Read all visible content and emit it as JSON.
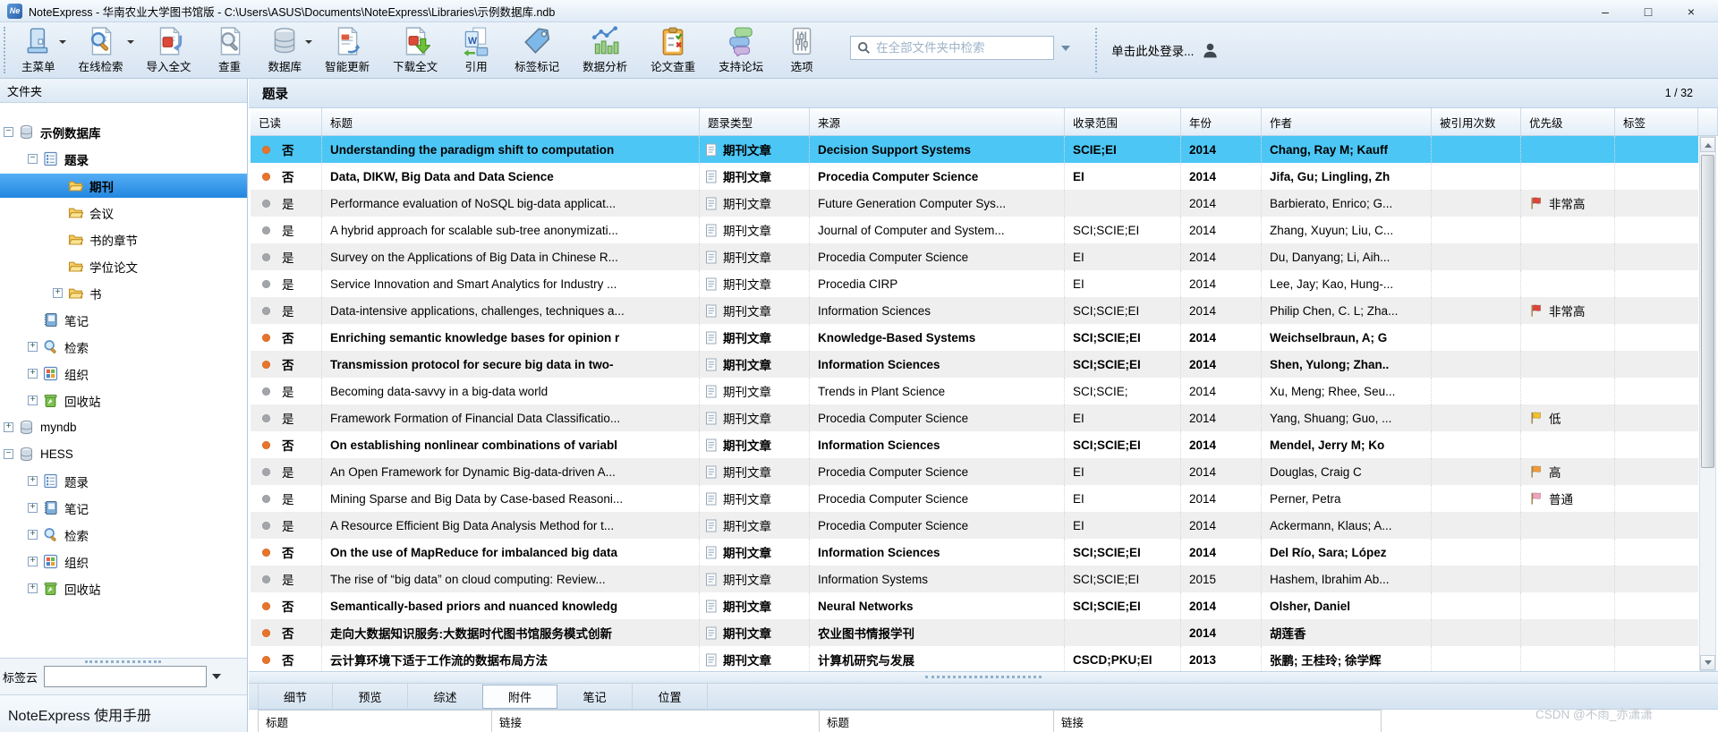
{
  "window": {
    "title": "NoteExpress - 华南农业大学图书馆版 - C:\\Users\\ASUS\\Documents\\NoteExpress\\Libraries\\示例数据库.ndb",
    "controls": {
      "minimize": "–",
      "maximize": "□",
      "close": "×"
    }
  },
  "toolbar": {
    "items": [
      {
        "label": "主菜单",
        "icon": "main-menu-icon",
        "dropdown": true
      },
      {
        "label": "在线检索",
        "icon": "online-search-icon",
        "dropdown": true
      },
      {
        "label": "导入全文",
        "icon": "import-fulltext-icon",
        "dropdown": false
      },
      {
        "label": "查重",
        "icon": "dedupe-icon",
        "dropdown": false
      },
      {
        "label": "数据库",
        "icon": "database-icon",
        "dropdown": true
      },
      {
        "label": "智能更新",
        "icon": "smart-update-icon",
        "dropdown": false
      },
      {
        "label": "下载全文",
        "icon": "download-fulltext-icon",
        "dropdown": false
      },
      {
        "label": "引用",
        "icon": "cite-icon",
        "dropdown": false
      },
      {
        "label": "标签标记",
        "icon": "tag-mark-icon",
        "dropdown": false
      },
      {
        "label": "数据分析",
        "icon": "data-analysis-icon",
        "dropdown": false
      },
      {
        "label": "论文查重",
        "icon": "paper-check-icon",
        "dropdown": false
      },
      {
        "label": "支持论坛",
        "icon": "forum-icon",
        "dropdown": false
      },
      {
        "label": "选项",
        "icon": "options-icon",
        "dropdown": false
      }
    ],
    "search": {
      "placeholder": "在全部文件夹中检索",
      "value": ""
    },
    "login_label": "单击此处登录..."
  },
  "sidebar": {
    "header": "文件夹",
    "tree": [
      {
        "label": "示例数据库",
        "icon": "database",
        "level": 0,
        "expander": "minus",
        "selected": false,
        "bold": true
      },
      {
        "label": "题录",
        "icon": "list",
        "level": 1,
        "expander": "minus",
        "selected": false,
        "bold": true
      },
      {
        "label": "期刊",
        "icon": "folder",
        "level": 2,
        "expander": "none",
        "selected": true,
        "bold": true
      },
      {
        "label": "会议",
        "icon": "folder",
        "level": 2,
        "expander": "none",
        "selected": false,
        "bold": false
      },
      {
        "label": "书的章节",
        "icon": "folder",
        "level": 2,
        "expander": "none",
        "selected": false,
        "bold": false
      },
      {
        "label": "学位论文",
        "icon": "folder",
        "level": 2,
        "expander": "none",
        "selected": false,
        "bold": false
      },
      {
        "label": "书",
        "icon": "folder",
        "level": 2,
        "expander": "plus",
        "selected": false,
        "bold": false
      },
      {
        "label": "笔记",
        "icon": "notebook",
        "level": 1,
        "expander": "none",
        "selected": false,
        "bold": false
      },
      {
        "label": "检索",
        "icon": "search",
        "level": 1,
        "expander": "plus",
        "selected": false,
        "bold": false
      },
      {
        "label": "组织",
        "icon": "grid",
        "level": 1,
        "expander": "plus",
        "selected": false,
        "bold": false
      },
      {
        "label": "回收站",
        "icon": "trash",
        "level": 1,
        "expander": "plus",
        "selected": false,
        "bold": false
      },
      {
        "label": "myndb",
        "icon": "database",
        "level": 0,
        "expander": "plus",
        "selected": false,
        "bold": false
      },
      {
        "label": "HESS",
        "icon": "database",
        "level": 0,
        "expander": "minus",
        "selected": false,
        "bold": false
      },
      {
        "label": "题录",
        "icon": "list",
        "level": 1,
        "expander": "plus",
        "selected": false,
        "bold": false
      },
      {
        "label": "笔记",
        "icon": "notebook",
        "level": 1,
        "expander": "plus",
        "selected": false,
        "bold": false
      },
      {
        "label": "检索",
        "icon": "search",
        "level": 1,
        "expander": "plus",
        "selected": false,
        "bold": false
      },
      {
        "label": "组织",
        "icon": "grid",
        "level": 1,
        "expander": "plus",
        "selected": false,
        "bold": false
      },
      {
        "label": "回收站",
        "icon": "trash",
        "level": 1,
        "expander": "plus",
        "selected": false,
        "bold": false
      }
    ],
    "tag_cloud_label": "标签云",
    "tag_cloud_value": "",
    "manual_label": "NoteExpress  使用手册"
  },
  "main": {
    "title": "题录",
    "page_indicator": "1 / 32",
    "columns": [
      "已读",
      "标题",
      "题录类型",
      "来源",
      "收录范围",
      "年份",
      "作者",
      "被引用次数",
      "优先级",
      "标签"
    ],
    "rows": [
      {
        "read_state": "否",
        "unread": true,
        "selected": true,
        "title": "Understanding the paradigm shift to computation",
        "type": "期刊文章",
        "source": "Decision Support Systems",
        "scope": "SCIE;EI",
        "year": "2014",
        "authors": "Chang, Ray M; Kauff",
        "cited": "",
        "priority": "",
        "priority_color": "",
        "tag": ""
      },
      {
        "read_state": "否",
        "unread": true,
        "selected": false,
        "title": "Data, DIKW, Big Data and Data Science",
        "type": "期刊文章",
        "source": "Procedia Computer Science",
        "scope": "EI",
        "year": "2014",
        "authors": "Jifa, Gu; Lingling, Zh",
        "cited": "",
        "priority": "",
        "priority_color": "",
        "tag": ""
      },
      {
        "read_state": "是",
        "unread": false,
        "selected": false,
        "title": "Performance evaluation of NoSQL big-data applicat...",
        "type": "期刊文章",
        "source": "Future Generation Computer Sys...",
        "scope": "",
        "year": "2014",
        "authors": "Barbierato, Enrico; G...",
        "cited": "",
        "priority": "非常高",
        "priority_color": "#e04438",
        "tag": ""
      },
      {
        "read_state": "是",
        "unread": false,
        "selected": false,
        "title": "A hybrid approach for scalable sub-tree anonymizati...",
        "type": "期刊文章",
        "source": "Journal of Computer and System...",
        "scope": "SCI;SCIE;EI",
        "year": "2014",
        "authors": "Zhang, Xuyun; Liu, C...",
        "cited": "",
        "priority": "",
        "priority_color": "",
        "tag": ""
      },
      {
        "read_state": "是",
        "unread": false,
        "selected": false,
        "title": "Survey on the Applications of Big Data in Chinese R...",
        "type": "期刊文章",
        "source": "Procedia Computer Science",
        "scope": "EI",
        "year": "2014",
        "authors": "Du, Danyang; Li, Aih...",
        "cited": "",
        "priority": "",
        "priority_color": "",
        "tag": ""
      },
      {
        "read_state": "是",
        "unread": false,
        "selected": false,
        "title": "Service Innovation and Smart Analytics for Industry ...",
        "type": "期刊文章",
        "source": "Procedia CIRP",
        "scope": "EI",
        "year": "2014",
        "authors": "Lee, Jay; Kao, Hung-...",
        "cited": "",
        "priority": "",
        "priority_color": "",
        "tag": ""
      },
      {
        "read_state": "是",
        "unread": false,
        "selected": false,
        "title": "Data-intensive applications, challenges, techniques a...",
        "type": "期刊文章",
        "source": "Information Sciences",
        "scope": "SCI;SCIE;EI",
        "year": "2014",
        "authors": "Philip Chen, C. L; Zha...",
        "cited": "",
        "priority": "非常高",
        "priority_color": "#e04438",
        "tag": ""
      },
      {
        "read_state": "否",
        "unread": true,
        "selected": false,
        "title": "Enriching semantic knowledge bases for opinion r",
        "type": "期刊文章",
        "source": "Knowledge-Based Systems",
        "scope": "SCI;SCIE;EI",
        "year": "2014",
        "authors": "Weichselbraun, A; G",
        "cited": "",
        "priority": "",
        "priority_color": "",
        "tag": ""
      },
      {
        "read_state": "否",
        "unread": true,
        "selected": false,
        "title": "Transmission protocol for secure big data in two-",
        "type": "期刊文章",
        "source": "Information Sciences",
        "scope": "SCI;SCIE;EI",
        "year": "2014",
        "authors": "Shen, Yulong; Zhan..",
        "cited": "",
        "priority": "",
        "priority_color": "",
        "tag": ""
      },
      {
        "read_state": "是",
        "unread": false,
        "selected": false,
        "title": "Becoming data-savvy in a big-data world",
        "type": "期刊文章",
        "source": "Trends in Plant Science",
        "scope": "SCI;SCIE;",
        "year": "2014",
        "authors": "Xu, Meng; Rhee, Seu...",
        "cited": "",
        "priority": "",
        "priority_color": "",
        "tag": ""
      },
      {
        "read_state": "是",
        "unread": false,
        "selected": false,
        "title": "Framework Formation of Financial Data Classificatio...",
        "type": "期刊文章",
        "source": "Procedia Computer Science",
        "scope": "EI",
        "year": "2014",
        "authors": "Yang, Shuang; Guo, ...",
        "cited": "",
        "priority": "低",
        "priority_color": "#f2c02c",
        "tag": ""
      },
      {
        "read_state": "否",
        "unread": true,
        "selected": false,
        "title": "On establishing nonlinear combinations of variabl",
        "type": "期刊文章",
        "source": "Information Sciences",
        "scope": "SCI;SCIE;EI",
        "year": "2014",
        "authors": "Mendel, Jerry M; Ko",
        "cited": "",
        "priority": "",
        "priority_color": "",
        "tag": ""
      },
      {
        "read_state": "是",
        "unread": false,
        "selected": false,
        "title": "An Open Framework for Dynamic Big-data-driven A...",
        "type": "期刊文章",
        "source": "Procedia Computer Science",
        "scope": "EI",
        "year": "2014",
        "authors": "Douglas, Craig C",
        "cited": "",
        "priority": "高",
        "priority_color": "#f59a36",
        "tag": ""
      },
      {
        "read_state": "是",
        "unread": false,
        "selected": false,
        "title": "Mining Sparse and Big Data by Case-based Reasoni...",
        "type": "期刊文章",
        "source": "Procedia Computer Science",
        "scope": "EI",
        "year": "2014",
        "authors": "Perner, Petra",
        "cited": "",
        "priority": "普通",
        "priority_color": "#f2a0c4",
        "tag": ""
      },
      {
        "read_state": "是",
        "unread": false,
        "selected": false,
        "title": "A Resource Efficient Big Data Analysis Method for t...",
        "type": "期刊文章",
        "source": "Procedia Computer Science",
        "scope": "EI",
        "year": "2014",
        "authors": "Ackermann, Klaus; A...",
        "cited": "",
        "priority": "",
        "priority_color": "",
        "tag": ""
      },
      {
        "read_state": "否",
        "unread": true,
        "selected": false,
        "title": "On the use of MapReduce for imbalanced big data",
        "type": "期刊文章",
        "source": "Information Sciences",
        "scope": "SCI;SCIE;EI",
        "year": "2014",
        "authors": "Del Río, Sara; López",
        "cited": "",
        "priority": "",
        "priority_color": "",
        "tag": ""
      },
      {
        "read_state": "是",
        "unread": false,
        "selected": false,
        "title": "The rise of “big data” on cloud computing: Review...",
        "type": "期刊文章",
        "source": "Information Systems",
        "scope": "SCI;SCIE;EI",
        "year": "2015",
        "authors": "Hashem, Ibrahim Ab...",
        "cited": "",
        "priority": "",
        "priority_color": "",
        "tag": ""
      },
      {
        "read_state": "否",
        "unread": true,
        "selected": false,
        "title": "Semantically-based priors and nuanced knowledg",
        "type": "期刊文章",
        "source": "Neural Networks",
        "scope": "SCI;SCIE;EI",
        "year": "2014",
        "authors": "Olsher, Daniel",
        "cited": "",
        "priority": "",
        "priority_color": "",
        "tag": ""
      },
      {
        "read_state": "否",
        "unread": true,
        "selected": false,
        "title": "走向大数据知识服务:大数据时代图书馆服务模式创新",
        "type": "期刊文章",
        "source": "农业图书情报学刊",
        "scope": "",
        "year": "2014",
        "authors": "胡莲香",
        "cited": "",
        "priority": "",
        "priority_color": "",
        "tag": ""
      },
      {
        "read_state": "否",
        "unread": true,
        "selected": false,
        "title": "云计算环境下适于工作流的数据布局方法",
        "type": "期刊文章",
        "source": "计算机研究与发展",
        "scope": "CSCD;PKU;EI",
        "year": "2013",
        "authors": "张鹏; 王桂玲; 徐学辉",
        "cited": "",
        "priority": "",
        "priority_color": "",
        "tag": ""
      }
    ]
  },
  "bottom": {
    "tabs": [
      {
        "label": "细节",
        "active": false
      },
      {
        "label": "预览",
        "active": false
      },
      {
        "label": "综述",
        "active": false
      },
      {
        "label": "附件",
        "active": true
      },
      {
        "label": "笔记",
        "active": false
      },
      {
        "label": "位置",
        "active": false
      }
    ],
    "panel_headers": [
      "标题",
      "链接",
      "标题",
      "链接"
    ]
  },
  "watermark": "CSDN @不雨_亦潇潇",
  "colors": {
    "selected_row": "#4cc7f5",
    "tree_selected": "#2e9bf0",
    "unread_dot": "#e8742c",
    "read_dot": "#a2a6aa",
    "priority_very_high": "#e04438",
    "priority_high": "#f59a36",
    "priority_low": "#f2c02c",
    "priority_normal": "#f2a0c4"
  }
}
